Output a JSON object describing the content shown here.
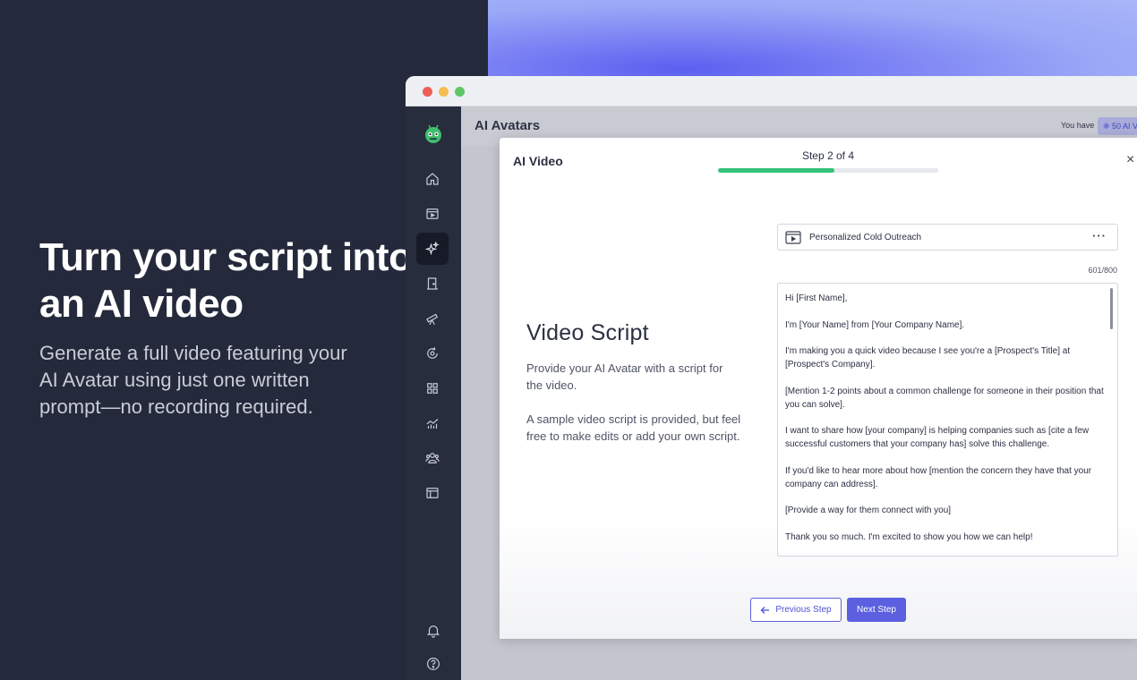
{
  "hero": {
    "title": "Turn your script into an AI video",
    "subtitle": "Generate a full video featuring your AI Avatar using just one written prompt—no recording required."
  },
  "app": {
    "page_title": "AI Avatars",
    "credits_text": "You have",
    "credits_badge": "❈ 50 AI V",
    "sidebar": {
      "items": [
        {
          "icon": "home-icon",
          "active": false
        },
        {
          "icon": "video-icon",
          "active": false
        },
        {
          "icon": "sparkles-icon",
          "active": true
        },
        {
          "icon": "door-icon",
          "active": false
        },
        {
          "icon": "telescope-icon",
          "active": false
        },
        {
          "icon": "refresh-icon",
          "active": false
        },
        {
          "icon": "grid-icon",
          "active": false
        },
        {
          "icon": "analytics-icon",
          "active": false
        },
        {
          "icon": "team-icon",
          "active": false
        },
        {
          "icon": "layout-icon",
          "active": false
        }
      ],
      "bottom": [
        "bell-icon",
        "help-icon"
      ]
    }
  },
  "modal": {
    "title": "AI Video",
    "close": "×",
    "step_label": "Step 2 of 4",
    "progress": 0.53,
    "section_title": "Video Script",
    "section_desc": "Provide your AI Avatar with a script for the video.",
    "section_note": "A sample video script is provided, but feel free to make edits or add your own script.",
    "template_name": "Personalized Cold Outreach",
    "more": "···",
    "char_count": "601/800",
    "script_paragraphs": [
      "Hi [First Name],",
      "I'm [Your Name] from [Your Company Name].",
      "I'm making you a quick video because I see you're a [Prospect's Title] at [Prospect's Company].",
      "[Mention 1-2 points about a common challenge for someone in their position that you can solve].",
      "I want to share how [your company] is helping companies such as [cite a few successful customers that your company has] solve this challenge.",
      "If you'd like to hear more about how [mention the concern they have that your company can address].",
      "[Provide a way for them connect with you]",
      "Thank you so much. I'm excited to show you how we can help!"
    ],
    "prev_label": "Previous Step",
    "next_label": "Next Step"
  },
  "colors": {
    "accent": "#5b5fe0",
    "progress": "#35c277",
    "sidebar": "#272d3d",
    "background": "#242a3b"
  }
}
